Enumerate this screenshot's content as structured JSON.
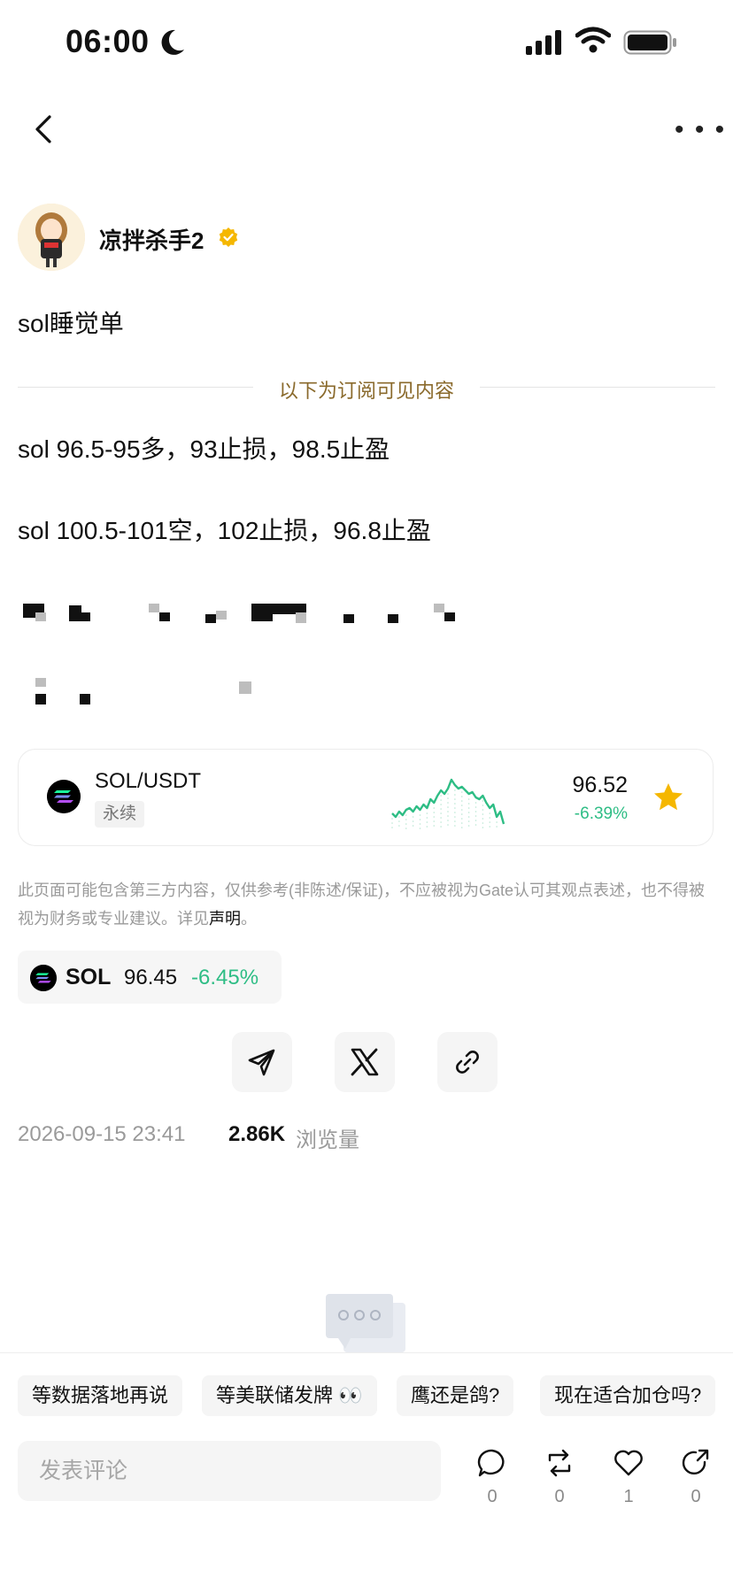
{
  "status_bar": {
    "time": "06:00"
  },
  "author": {
    "name": "凉拌杀手2",
    "verified_icon": "verified-badge-icon",
    "accent": "#f5b700"
  },
  "post": {
    "title": "sol睡觉单",
    "subscription_divider": "以下为订阅可见内容",
    "lines": [
      "sol 96.5-95多，93止损，98.5止盈",
      "sol 100.5-101空，102止损，96.8止盈"
    ]
  },
  "market_card": {
    "pair": "SOL/USDT",
    "tag": "永续",
    "price": "96.52",
    "change": "-6.39%",
    "change_color": "#2ebd85",
    "star_color": "#f5b700",
    "sparkline": [
      46,
      50,
      44,
      48,
      42,
      40,
      44,
      38,
      42,
      36,
      40,
      30,
      34,
      26,
      20,
      24,
      18,
      8,
      14,
      18,
      16,
      20,
      24,
      22,
      28,
      30,
      26,
      34,
      40,
      36,
      50,
      44,
      58
    ]
  },
  "disclaimer": {
    "text": "此页面可能包含第三方内容，仅供参考(非陈述/保证)，不应被视为Gate认可其观点表述，也不得被视为财务或专业建议。详见",
    "link": "声明",
    "tail": "。"
  },
  "coin_chip": {
    "symbol": "SOL",
    "price": "96.45",
    "change": "-6.45%"
  },
  "share": {
    "icons": [
      "telegram-icon",
      "x-icon",
      "link-icon"
    ]
  },
  "meta": {
    "datetime": "2026-09-15 23:41",
    "views": "2.86K",
    "views_label": "浏览量"
  },
  "suggestion_chips": [
    "等数据落地再说",
    "等美联储发牌 👀",
    "鹰还是鸽?",
    "现在适合加仓吗?"
  ],
  "comment_box": {
    "placeholder": "发表评论"
  },
  "actions": [
    {
      "icon": "comment-icon",
      "count": "0"
    },
    {
      "icon": "repost-icon",
      "count": "0"
    },
    {
      "icon": "like-icon",
      "count": "1"
    },
    {
      "icon": "share-icon",
      "count": "0"
    }
  ]
}
